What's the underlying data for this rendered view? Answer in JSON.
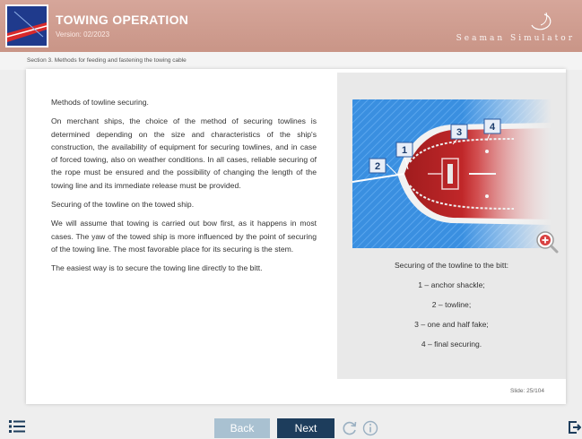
{
  "header": {
    "title": "TOWING OPERATION",
    "version": "Version: 02/2023",
    "brand": "Seaman Simulator"
  },
  "section": {
    "text": "Section 3. Methods for feeding and fastening the towing cable"
  },
  "content": {
    "paragraphs": [
      "Methods of towline securing.",
      "On merchant ships, the choice of the method of securing towlines is determined depending on the size and characteristics of the ship's construction, the availability of equipment for securing towlines, and in case of forced towing, also on weather conditions. In all cases, reliable securing of the rope must be ensured and the possibility of changing the length of the towing line and its immediate release must be provided.",
      "Securing of the towline on the towed ship.",
      "We will assume that towing is carried out bow first, as it happens in most cases. The yaw of the towed ship is more influenced by the point of securing of the towing line. The most favorable place for its securing is the stem.",
      "The easiest way is to secure the towing line directly to the bitt."
    ]
  },
  "figure": {
    "labels": [
      "1",
      "2",
      "3",
      "4"
    ],
    "caption_title": "Securing of the towline to the bitt:",
    "caption_items": [
      "1 – anchor shackle;",
      "2 – towline;",
      "3 – one and half fake;",
      "4 – final securing."
    ]
  },
  "slide": {
    "counter": "Slide: 25/104"
  },
  "footer": {
    "back_label": "Back",
    "next_label": "Next"
  },
  "icons": {
    "menu": "menu-list-icon",
    "reload": "reload-icon",
    "info": "info-icon",
    "exit": "exit-icon",
    "zoom": "zoom-in-icon"
  },
  "colors": {
    "header": "#c99587",
    "next_button": "#1d3d5c",
    "back_button": "#a9c1d1",
    "ship_hull": "#c0282a",
    "water": "#3a8fe0"
  }
}
